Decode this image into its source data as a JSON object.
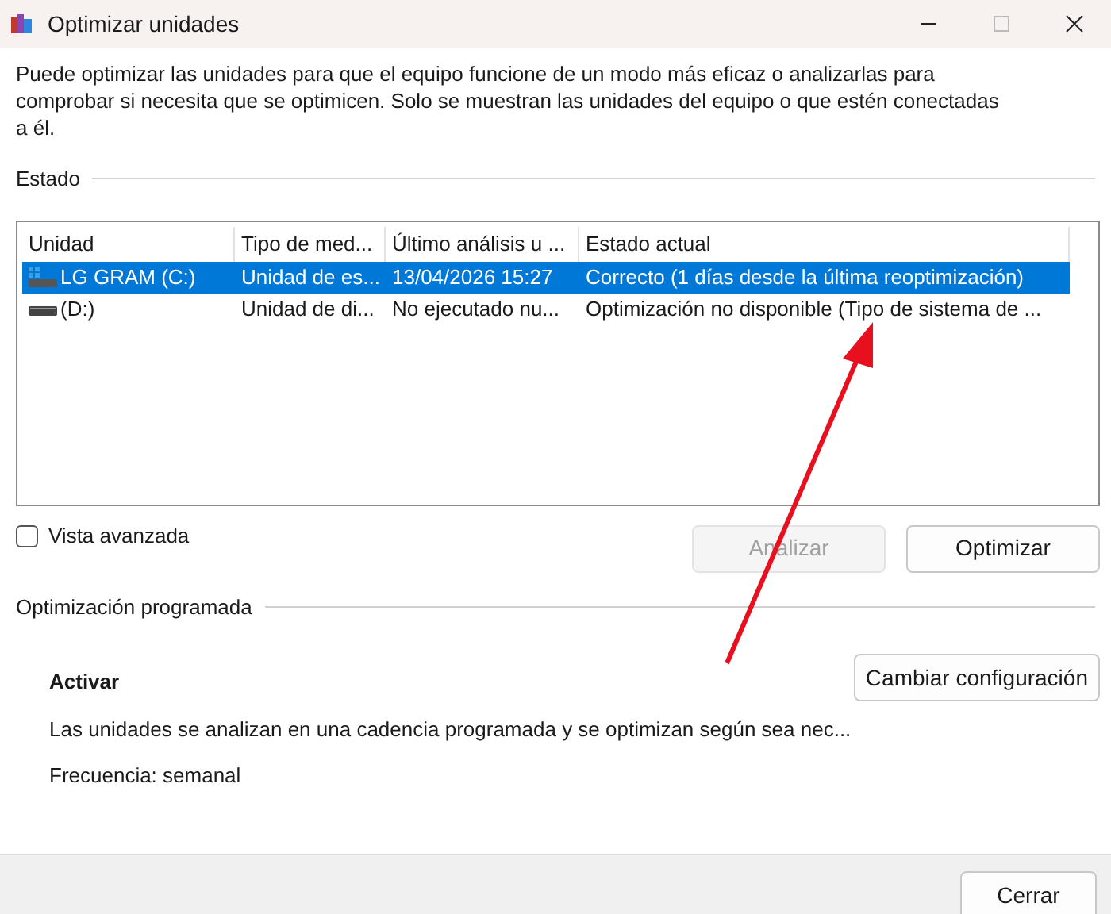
{
  "window": {
    "title": "Optimizar unidades"
  },
  "description": "Puede optimizar las unidades para que el equipo funcione de un modo más eficaz o analizarlas para comprobar si necesita que se optimicen. Solo se muestran las unidades del equipo o que estén conectadas a él.",
  "status_section": {
    "label": "Estado"
  },
  "table": {
    "columns": [
      "Unidad",
      "Tipo de med...",
      "Último análisis u ...",
      "Estado actual"
    ],
    "rows": [
      {
        "kind": "system",
        "selected": true,
        "cells": [
          "LG GRAM (C:)",
          "Unidad de es...",
          "13/04/2026 15:27",
          "Correcto (1 días desde la última reoptimización)"
        ]
      },
      {
        "kind": "disk",
        "selected": false,
        "cells": [
          "(D:)",
          "Unidad de di...",
          "No ejecutado nu...",
          "Optimización no disponible (Tipo de sistema de ..."
        ]
      }
    ]
  },
  "advanced_view": {
    "label": "Vista avanzada",
    "checked": false
  },
  "actions": [
    {
      "label": "Analizar",
      "disabled": true
    },
    {
      "label": "Optimizar",
      "disabled": false
    }
  ],
  "scheduled": {
    "label": "Optimización programada",
    "heading": "Activar",
    "description": "Las unidades se analizan en una cadencia programada y se optimizan según sea nec...",
    "frequency": "Frecuencia: semanal",
    "button": "Cambiar configuración"
  },
  "footer": {
    "button": "Cerrar"
  }
}
